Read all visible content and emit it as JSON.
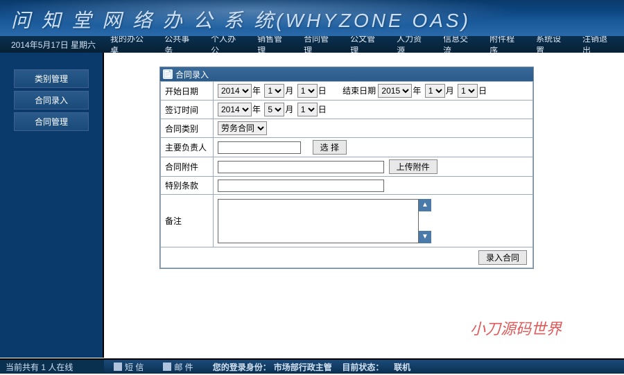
{
  "header": {
    "title": "问 知 堂 网 络 办 公 系 统(WHYZONE OAS)"
  },
  "date_bar": {
    "date": "2014年5月17日 星期六"
  },
  "nav": [
    "我的办公桌",
    "公共事务",
    "个人办公",
    "销售管理",
    "合同管理",
    "公文管理",
    "人力资源",
    "信息交流",
    "附件程序",
    "系统设置",
    "注销退出"
  ],
  "sidebar": [
    "类别管理",
    "合同录入",
    "合同管理"
  ],
  "form": {
    "title": "合同录入",
    "labels": {
      "start_date": "开始日期",
      "end_date": "结束日期",
      "sign_time": "签订时间",
      "contract_type": "合同类别",
      "responsible": "主要负责人",
      "attachment": "合同附件",
      "special_terms": "特别条款",
      "remark": "备注"
    },
    "units": {
      "year": "年",
      "month": "月",
      "day": "日"
    },
    "start": {
      "year": "2014",
      "month": "1",
      "day": "1"
    },
    "end": {
      "year": "2015",
      "month": "1",
      "day": "1"
    },
    "sign": {
      "year": "2014",
      "month": "5",
      "day": "1"
    },
    "type_value": "劳务合同",
    "buttons": {
      "select": "选 择",
      "upload": "上传附件",
      "submit": "录入合同"
    }
  },
  "watermark": "小刀源码世界",
  "footer": {
    "online": "当前共有 1 人在线",
    "sms": "短 信",
    "mail": "邮 件",
    "identity_label": "您的登录身份：",
    "identity_value": "市场部行政主管",
    "status_label": "目前状态：",
    "status_value": "联机"
  }
}
